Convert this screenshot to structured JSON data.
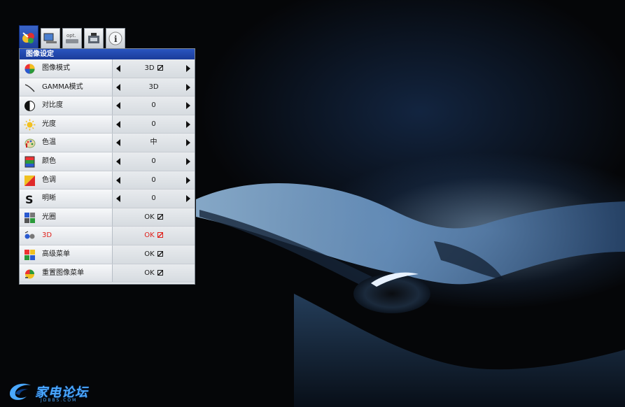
{
  "menu": {
    "title": "图像设定",
    "tabs": [
      {
        "icon": "picture-settings-icon",
        "label": ""
      },
      {
        "icon": "display-icon",
        "label": ""
      },
      {
        "icon": "options-icon",
        "label": "opt."
      },
      {
        "icon": "projector-setup-icon",
        "label": ""
      },
      {
        "icon": "info-icon",
        "label": "i"
      }
    ],
    "rows": [
      {
        "label": "图像模式",
        "value": "3D",
        "arrows": true,
        "ok_box": true,
        "icon": "color-wheel-icon"
      },
      {
        "label": "GAMMA模式",
        "value": "3D",
        "arrows": true,
        "ok_box": false,
        "icon": "gamma-curve-icon"
      },
      {
        "label": "对比度",
        "value": "0",
        "arrows": true,
        "ok_box": false,
        "icon": "contrast-icon"
      },
      {
        "label": "光度",
        "value": "0",
        "arrows": true,
        "ok_box": false,
        "icon": "brightness-sun-icon"
      },
      {
        "label": "色温",
        "value": "中",
        "arrows": true,
        "ok_box": false,
        "icon": "thermometer-palette-icon"
      },
      {
        "label": "颜色",
        "value": "0",
        "arrows": true,
        "ok_box": false,
        "icon": "color-bars-icon"
      },
      {
        "label": "色调",
        "value": "0",
        "arrows": true,
        "ok_box": false,
        "icon": "tint-icon"
      },
      {
        "label": "明晰",
        "value": "0",
        "arrows": true,
        "ok_box": false,
        "icon": "sharpness-s-icon"
      },
      {
        "label": "光圈",
        "value": "OK",
        "arrows": false,
        "ok_box": true,
        "icon": "iris-icon"
      },
      {
        "label": "3D",
        "value": "OK",
        "arrows": false,
        "ok_box": true,
        "icon": "3d-glasses-icon",
        "highlight": true
      },
      {
        "label": "高级菜单",
        "value": "OK",
        "arrows": false,
        "ok_box": true,
        "icon": "advanced-menu-icon"
      },
      {
        "label": "重置图像菜单",
        "value": "OK",
        "arrows": false,
        "ok_box": true,
        "icon": "reset-picture-icon"
      }
    ]
  },
  "watermark": {
    "text": "家电论坛",
    "subtext": "JDBBS.COM"
  },
  "colors": {
    "highlight": "#e0201a",
    "title_bar": "#2a55c0",
    "watermark": "#4aa8ff"
  }
}
